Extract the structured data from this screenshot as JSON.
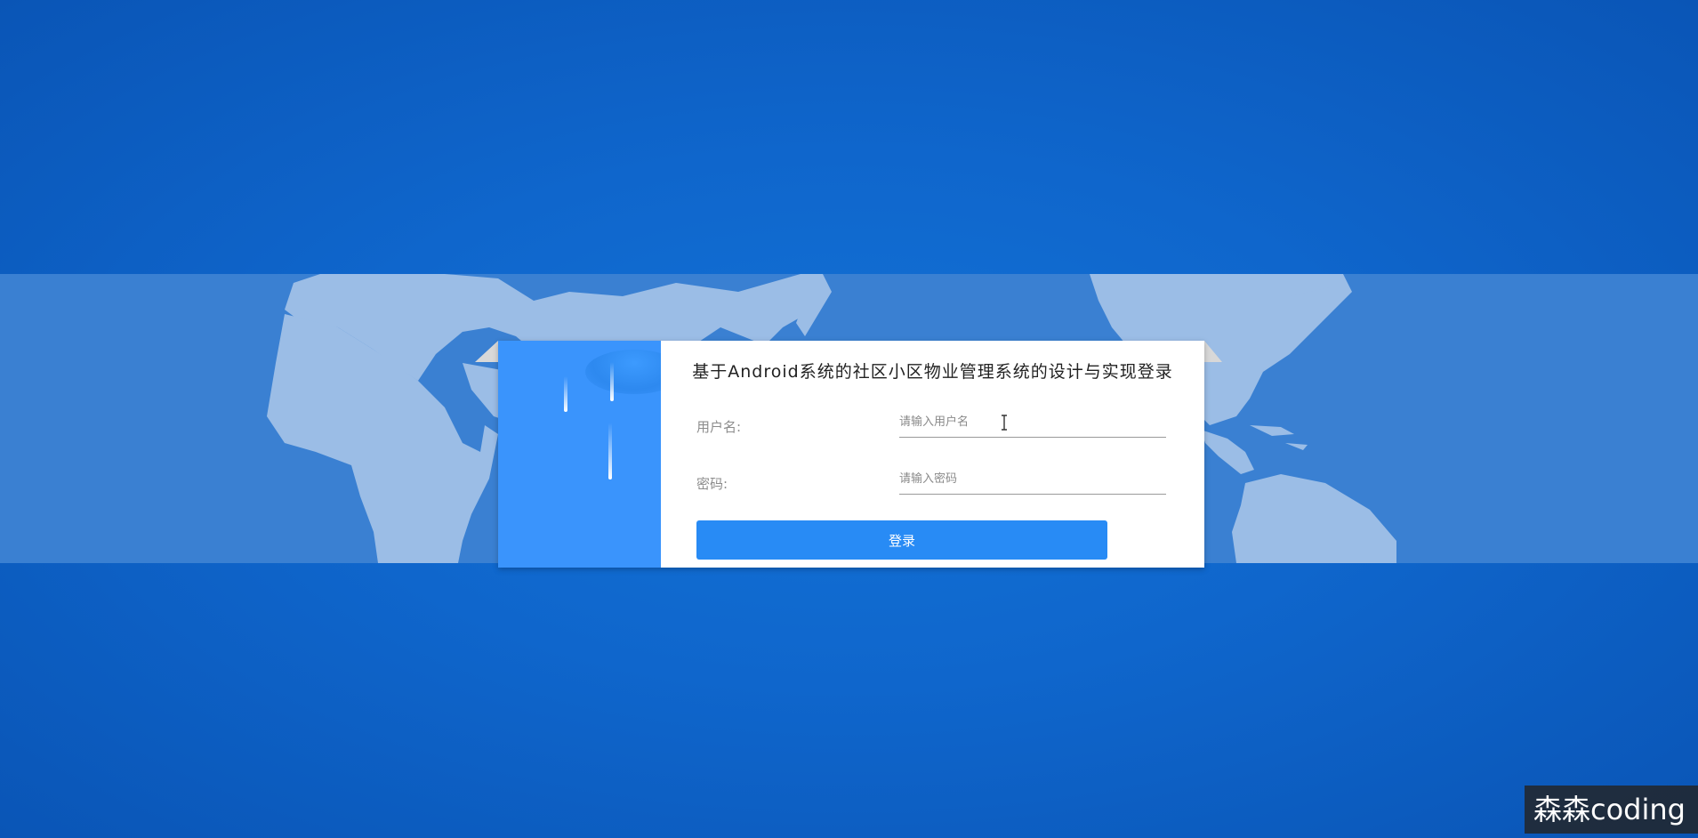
{
  "login": {
    "title": "基于Android系统的社区小区物业管理系统的设计与实现登录",
    "username_label": "用户名:",
    "username_placeholder": "请输入用户名",
    "username_value": "",
    "password_label": "密码:",
    "password_placeholder": "请输入密码",
    "password_value": "",
    "login_button_label": "登录"
  },
  "watermark": {
    "text": "森森coding"
  },
  "colors": {
    "background": "#0f66cc",
    "map_band": "#3a80d2",
    "land": "#9bbde6",
    "card_left": "#3a94fc",
    "button": "#288bf5"
  },
  "icons": {
    "cursor": "text-cursor-icon"
  }
}
